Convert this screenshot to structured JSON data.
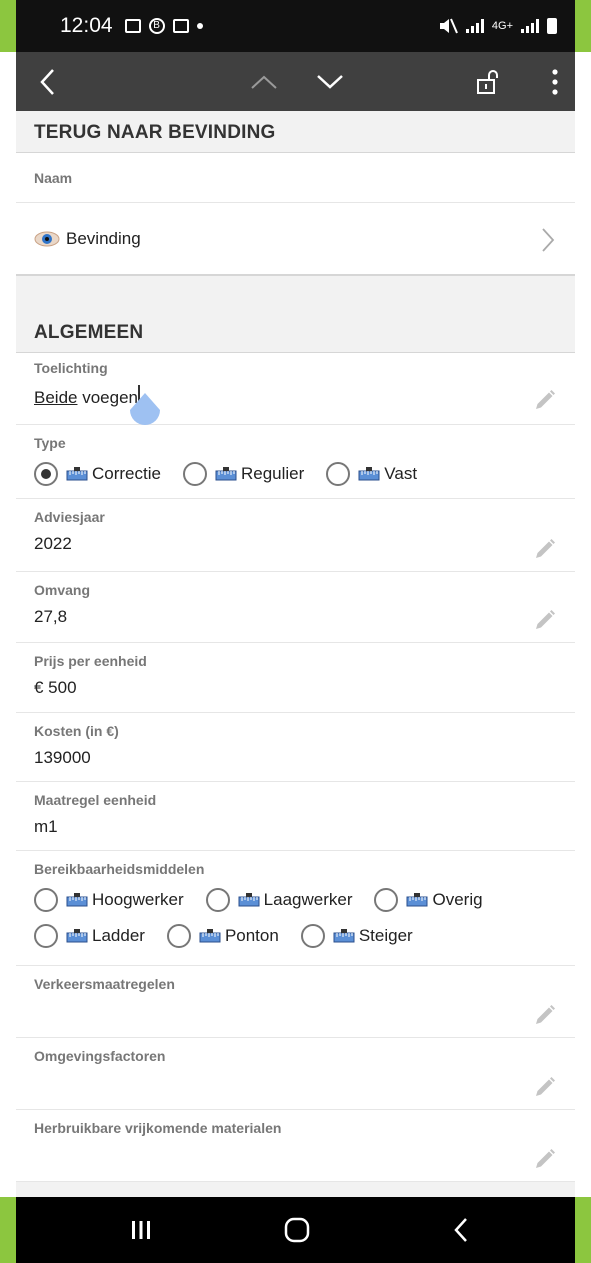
{
  "status": {
    "time": "12:04",
    "network": "4G+"
  },
  "header": {
    "back_section": "TERUG NAAR BEVINDING"
  },
  "name_block": {
    "label": "Naam",
    "value": "Bevinding"
  },
  "algemeen": {
    "title": "ALGEMEEN",
    "toelichting": {
      "label": "Toelichting",
      "value_a": "Beide",
      "value_b": " voegen"
    },
    "type": {
      "label": "Type",
      "options": [
        "Correctie",
        "Regulier",
        "Vast"
      ],
      "selected": "Correctie"
    },
    "adviesjaar": {
      "label": "Adviesjaar",
      "value": "2022"
    },
    "omvang": {
      "label": "Omvang",
      "value": "27,8"
    },
    "prijs": {
      "label": "Prijs per eenheid",
      "value": "€ 500"
    },
    "kosten": {
      "label": "Kosten (in €)",
      "value": "139000"
    },
    "maatregel": {
      "label": "Maatregel eenheid",
      "value": "m1"
    },
    "bereikbaarheid": {
      "label": "Bereikbaarheidsmiddelen",
      "options_row1": [
        "Hoogwerker",
        "Laagwerker",
        "Overig"
      ],
      "options_row2": [
        "Ladder",
        "Ponton",
        "Steiger"
      ]
    },
    "verkeer": {
      "label": "Verkeersmaatregelen",
      "value": ""
    },
    "omgeving": {
      "label": "Omgevingsfactoren",
      "value": ""
    },
    "herbruik": {
      "label": "Herbruikbare vrijkomende materialen",
      "value": ""
    }
  },
  "colors": {
    "accent": "#8cc63f",
    "toolbar": "#404040",
    "statusbar": "#111111"
  }
}
